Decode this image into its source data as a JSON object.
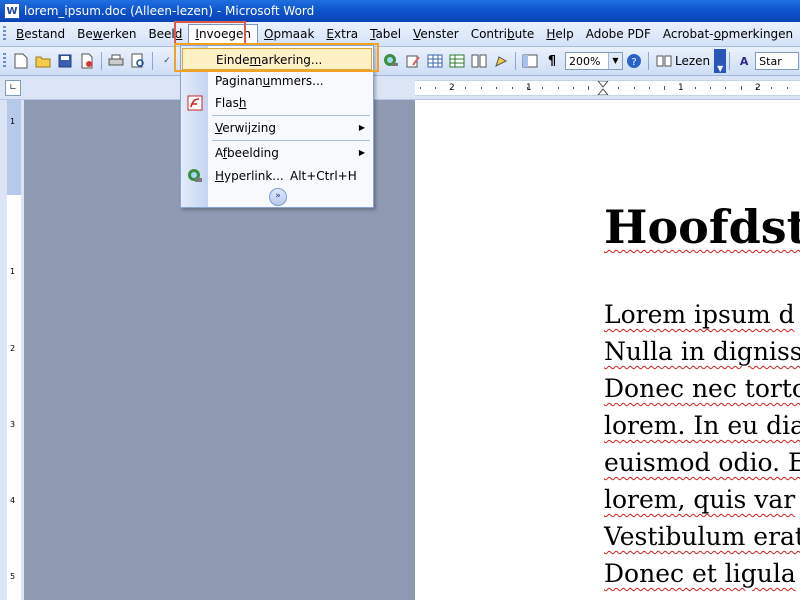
{
  "window": {
    "title": "lorem_ipsum.doc (Alleen-lezen) - Microsoft Word"
  },
  "menubar": {
    "items": [
      {
        "label": "Bestand"
      },
      {
        "label": "Bewerken"
      },
      {
        "label": "Beeld"
      },
      {
        "label": "Invoegen"
      },
      {
        "label": "Opmaak"
      },
      {
        "label": "Extra"
      },
      {
        "label": "Tabel"
      },
      {
        "label": "Venster"
      },
      {
        "label": "Contribute"
      },
      {
        "label": "Help"
      },
      {
        "label": "Adobe PDF"
      },
      {
        "label": "Acrobat-opmerkingen"
      }
    ]
  },
  "toolbar": {
    "zoom_value": "200%",
    "lezen_label": "Lezen",
    "style_label": "Star"
  },
  "dropdown": {
    "items": [
      {
        "label": "Eindemarkering...",
        "icon": "none"
      },
      {
        "label": "Paginanummers...",
        "icon": "none"
      },
      {
        "label": "Flash",
        "icon": "flash-icon"
      },
      {
        "label": "Verwijzing",
        "submenu": true
      },
      {
        "label": "Afbeelding",
        "submenu": true
      },
      {
        "label": "Hyperlink...",
        "shortcut": "Alt+Ctrl+H",
        "icon": "hyperlink-icon"
      }
    ]
  },
  "document": {
    "heading": "Hoofdstu",
    "lines": [
      "Lorem ipsum d",
      "Nulla in digniss",
      "Donec nec torto",
      "lorem. In eu dia",
      "euismod odio. E",
      "lorem, quis var",
      "Vestibulum erat",
      "Donec et ligula"
    ]
  },
  "rulers": {
    "h_labels": [
      "2",
      "1",
      "1",
      "2"
    ],
    "v_labels": [
      "1",
      "1",
      "2",
      "3",
      "4",
      "5"
    ]
  }
}
